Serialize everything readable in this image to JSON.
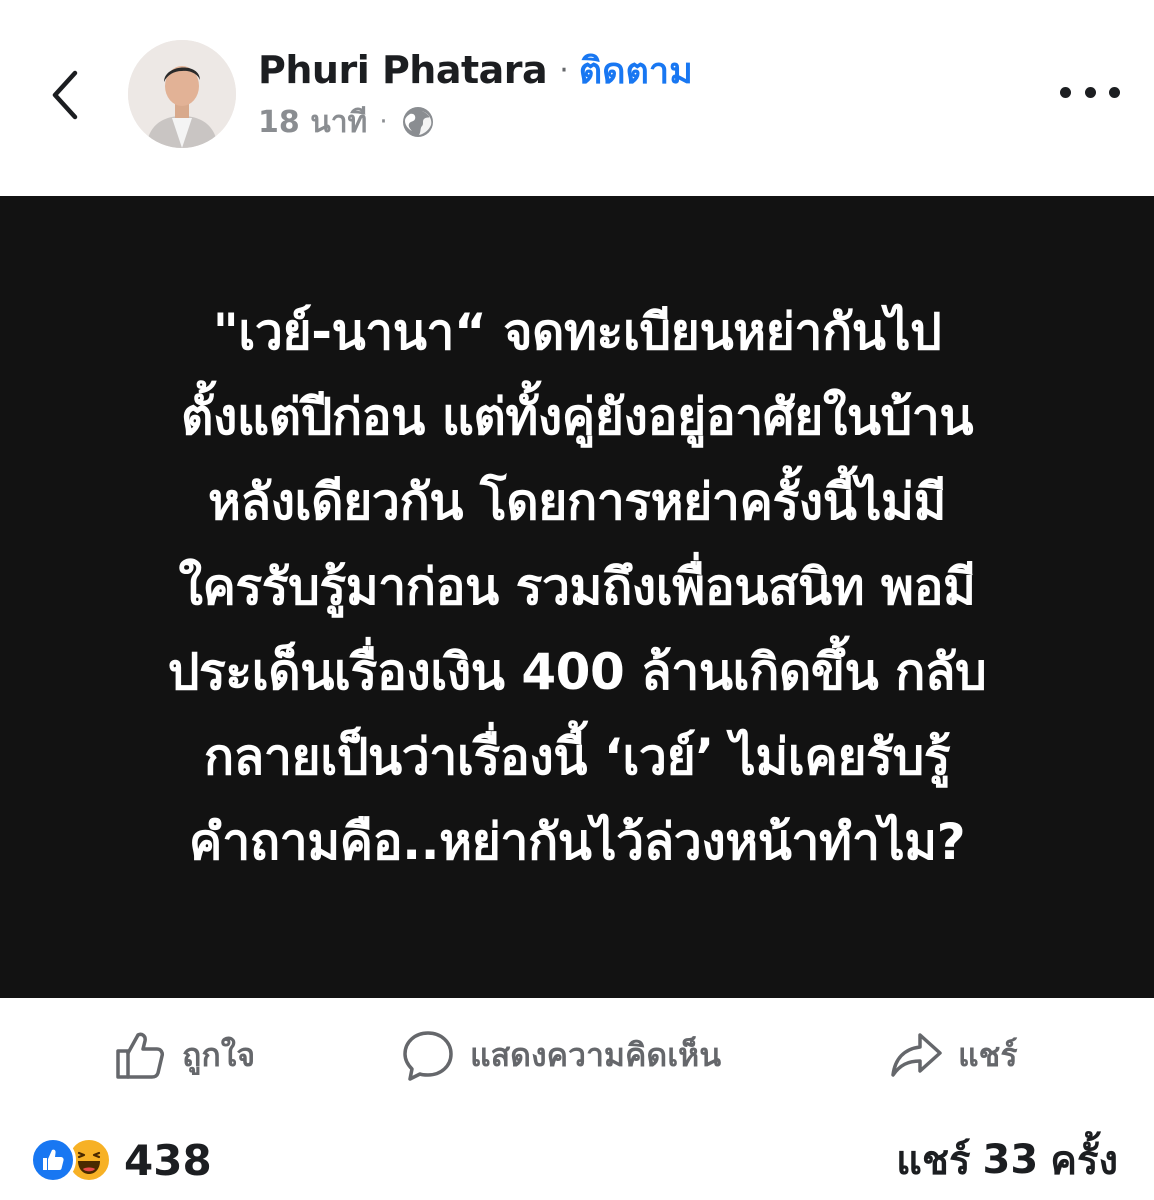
{
  "header": {
    "back_icon": "chevron-left-icon",
    "author_name": "Phuri Phatara",
    "separator": "·",
    "follow_label": "ติดตาม",
    "timestamp": "18 นาที",
    "meta_separator": "·",
    "privacy_icon": "globe-icon",
    "more_icon": "more-horizontal-icon"
  },
  "post": {
    "background_color": "#121212",
    "text_color": "#ffffff",
    "lines": [
      "\"เวย์-นานา“ จดทะเบียนหย่ากันไป",
      "ตั้งแต่ปีก่อน แต่ทั้งคู่ยังอยู่อาศัยในบ้าน",
      "หลังเดียวกัน โดยการหย่าครั้งนี้ไม่มี",
      "ใครรับรู้มาก่อน รวมถึงเพื่อนสนิท พอมี",
      "ประเด็นเรื่องเงิน 400 ล้านเกิดขึ้น กลับ",
      "กลายเป็นว่าเรื่องนี้ ‘เวย์’ ไม่เคยรับรู้",
      "คำถามคือ..หย่ากันไว้ล่วงหน้าทำไม?"
    ]
  },
  "actions": {
    "like_label": "ถูกใจ",
    "like_icon": "thumbs-up-icon",
    "comment_label": "แสดงความคิดเห็น",
    "comment_icon": "comment-bubble-icon",
    "share_label": "แชร์",
    "share_icon": "share-arrow-icon"
  },
  "summary": {
    "reaction_icons": [
      "like-reaction-icon",
      "haha-reaction-icon"
    ],
    "reaction_count": "438",
    "share_prefix": "แชร์",
    "share_count": "33",
    "share_suffix": "ครั้ง"
  },
  "colors": {
    "accent": "#1877f2",
    "secondary_text": "#65676b",
    "haha_yellow": "#f7b125"
  }
}
